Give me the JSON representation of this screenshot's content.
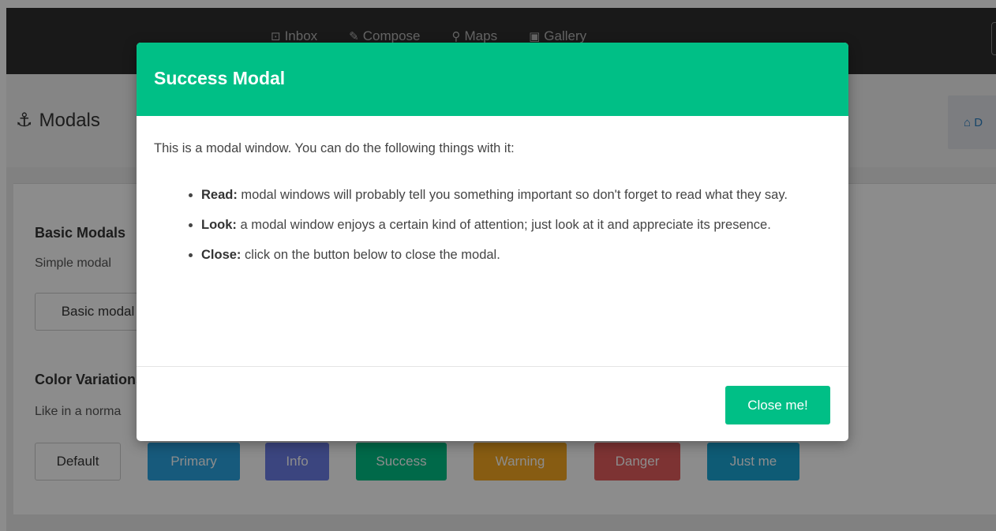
{
  "navbar": {
    "links": [
      {
        "icon": "inbox-icon",
        "glyph": "⊡",
        "label": "Inbox"
      },
      {
        "icon": "compose-icon",
        "glyph": "✎",
        "label": "Compose"
      },
      {
        "icon": "map-marker-icon",
        "glyph": "⚲",
        "label": "Maps"
      },
      {
        "icon": "gallery-icon",
        "glyph": "▣",
        "label": "Gallery"
      }
    ]
  },
  "header": {
    "title": "Modals",
    "dashboard_label": "D"
  },
  "content": {
    "basic": {
      "title": "Basic Modals",
      "text": "Simple modal",
      "button": "Basic modal"
    },
    "color": {
      "title": "Color Variations",
      "text": "Like in a norma",
      "buttons": [
        {
          "label": "Default",
          "color": "#ffffff",
          "text": "#333333"
        },
        {
          "label": "Primary",
          "color": "#2aa5e2",
          "text": "#ffffff"
        },
        {
          "label": "Info",
          "color": "#6c7fe8",
          "text": "#ffffff"
        },
        {
          "label": "Success",
          "color": "#00bf86",
          "text": "#ffffff"
        },
        {
          "label": "Warning",
          "color": "#f6a821",
          "text": "#ffffff"
        },
        {
          "label": "Danger",
          "color": "#e35e5e",
          "text": "#ffffff"
        },
        {
          "label": "Just me",
          "color": "#1aa6d6",
          "text": "#ffffff"
        }
      ]
    }
  },
  "modal": {
    "title": "Success Modal",
    "intro": "This is a modal window. You can do the following things with it:",
    "items": [
      {
        "term": "Read:",
        "text": " modal windows will probably tell you something important so don't forget to read what they say."
      },
      {
        "term": "Look:",
        "text": " a modal window enjoys a certain kind of attention; just look at it and appreciate its presence."
      },
      {
        "term": "Close:",
        "text": " click on the button below to close the modal."
      }
    ],
    "close_label": "Close me!",
    "accent": "#00bf86"
  }
}
